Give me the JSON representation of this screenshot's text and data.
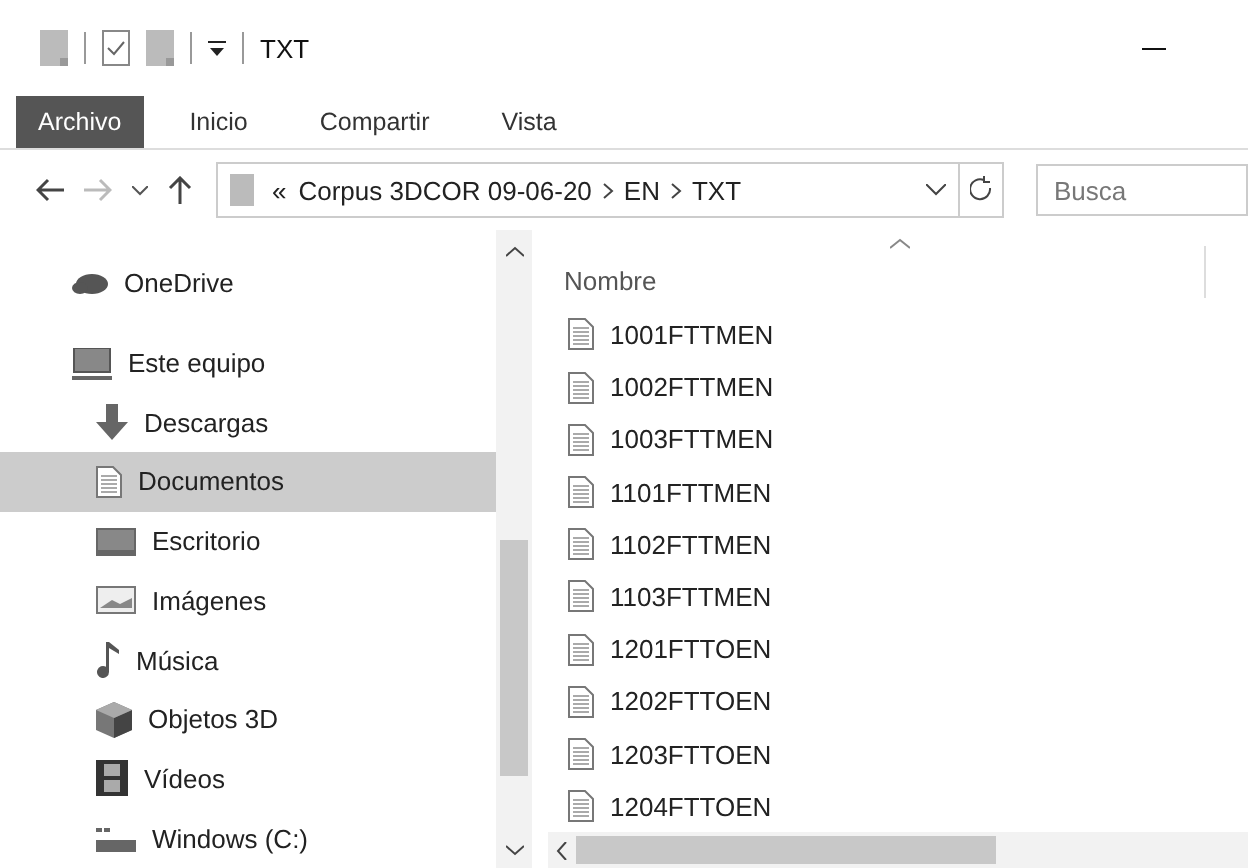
{
  "window": {
    "title": "TXT",
    "quick_access": [
      {
        "kind": "blank"
      },
      {
        "kind": "check"
      },
      {
        "kind": "blank"
      },
      {
        "kind": "dropdown"
      }
    ]
  },
  "ribbon_tabs": [
    {
      "label": "Archivo",
      "selected": true
    },
    {
      "label": "Inicio",
      "selected": false
    },
    {
      "label": "Compartir",
      "selected": false
    },
    {
      "label": "Vista",
      "selected": false
    }
  ],
  "address": {
    "overflow": "«",
    "crumbs": [
      "Corpus 3DCOR 09-06-20",
      "EN",
      "TXT"
    ]
  },
  "search": {
    "placeholder": "Busca"
  },
  "sidebar": {
    "items": [
      {
        "label": "OneDrive",
        "kind": "cloud",
        "selected": false
      },
      {
        "label": "Este equipo",
        "kind": "computer",
        "selected": false,
        "children": [
          {
            "label": "Descargas",
            "kind": "download",
            "selected": false
          },
          {
            "label": "Documentos",
            "kind": "document",
            "selected": true
          },
          {
            "label": "Escritorio",
            "kind": "desktop",
            "selected": false
          },
          {
            "label": "Imágenes",
            "kind": "image",
            "selected": false
          },
          {
            "label": "Música",
            "kind": "music",
            "selected": false
          },
          {
            "label": "Objetos 3D",
            "kind": "cube",
            "selected": false
          },
          {
            "label": "Vídeos",
            "kind": "film",
            "selected": false
          },
          {
            "label": "Windows (C:)",
            "kind": "drive",
            "selected": false
          }
        ]
      }
    ]
  },
  "file_list": {
    "columns": [
      "Nombre"
    ],
    "rows": [
      "1001FTTMEN",
      "1002FTTMEN",
      "1003FTTMEN",
      "1101FTTMEN",
      "1102FTTMEN",
      "1103FTTMEN",
      "1201FTTOEN",
      "1202FTTOEN",
      "1203FTTOEN",
      "1204FTTOEN"
    ]
  }
}
